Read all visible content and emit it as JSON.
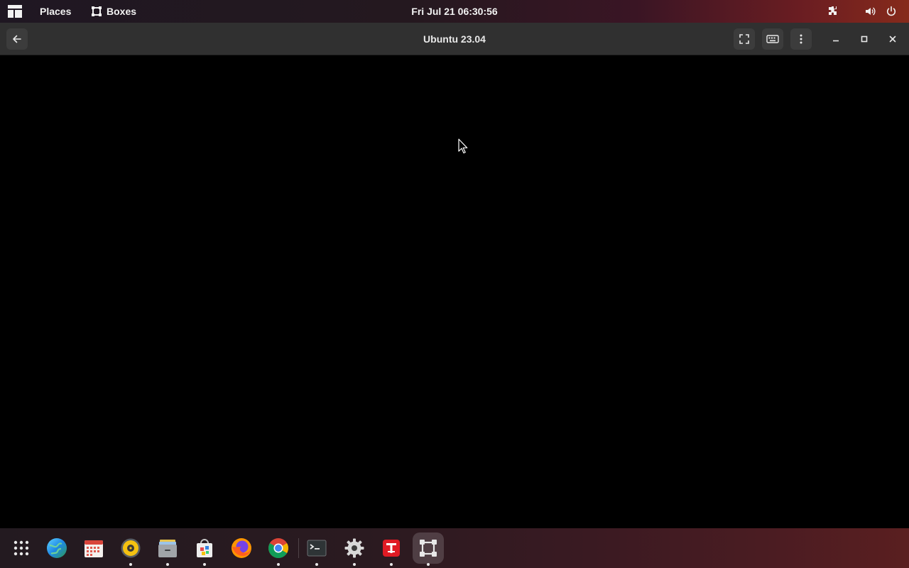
{
  "topbar": {
    "places_label": "Places",
    "app_menu_label": "Boxes",
    "clock": "Fri Jul 21  06:30:56",
    "tray": [
      "extension-icon",
      "volume-icon",
      "power-icon"
    ]
  },
  "window": {
    "title": "Ubuntu 23.04",
    "buttons": [
      "back-arrow-icon",
      "fullscreen-icon",
      "keyboard-icon",
      "more-vert-icon",
      "minimize-icon",
      "maximize-icon",
      "close-icon"
    ]
  },
  "dock": {
    "items": [
      {
        "name": "show-apps",
        "icon": "app-grid-icon",
        "running": false
      },
      {
        "name": "web-browser",
        "icon": "globe-icon",
        "running": false
      },
      {
        "name": "calendar",
        "icon": "calendar-icon",
        "running": false
      },
      {
        "name": "rhythmbox",
        "icon": "music-player-icon",
        "running": true
      },
      {
        "name": "files",
        "icon": "files-icon",
        "running": true
      },
      {
        "name": "software",
        "icon": "software-store-icon",
        "running": true
      },
      {
        "name": "firefox",
        "icon": "firefox-icon",
        "running": false
      },
      {
        "name": "chrome",
        "icon": "chrome-icon",
        "running": true
      },
      {
        "name": "terminal",
        "icon": "terminal-icon",
        "running": true
      },
      {
        "name": "settings",
        "icon": "settings-gear-icon",
        "running": true
      },
      {
        "name": "text-editor",
        "icon": "text-editor-icon",
        "running": true
      },
      {
        "name": "boxes",
        "icon": "boxes-icon",
        "running": true,
        "active": true
      }
    ]
  },
  "colors": {
    "headerbar": "#303030",
    "vm_display": "#000000",
    "topbar_accent": "#862a1b"
  }
}
